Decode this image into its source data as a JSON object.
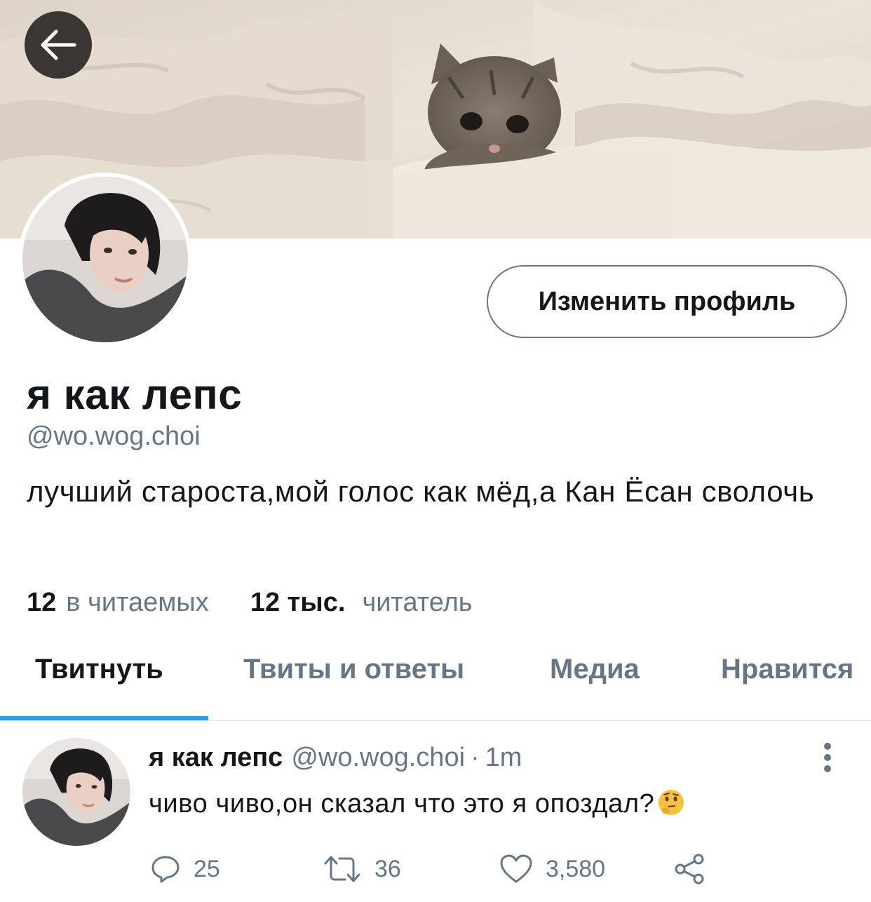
{
  "colors": {
    "accent": "#1da1f2",
    "text_primary": "#14171a",
    "text_secondary": "#657786"
  },
  "header": {
    "back_icon": "arrow-left-icon",
    "banner_image": "kitten-in-blanket"
  },
  "profile": {
    "edit_button_label": "Изменить профиль",
    "display_name": "я как лепс",
    "handle": "@wo.wog.choi",
    "bio": "лучший староста,мой голос как мёд,а Кан Ёсан сволочь",
    "following_count": "12",
    "following_label": "в читаемых",
    "followers_count": "12 тыс.",
    "followers_label": "читатель"
  },
  "tabs": [
    {
      "label": "Твитнуть",
      "active": true
    },
    {
      "label": "Твиты и ответы",
      "active": false
    },
    {
      "label": "Медиа",
      "active": false
    },
    {
      "label": "Нравится",
      "active": false
    }
  ],
  "tweet": {
    "name": "я как лепс",
    "handle": "@wo.wog.choi",
    "separator": "·",
    "time": "1m",
    "text": "чиво чиво,он сказал что это я опоздал?",
    "emoji": "thinking-face",
    "replies": "25",
    "retweets": "36",
    "likes": "3,580"
  }
}
